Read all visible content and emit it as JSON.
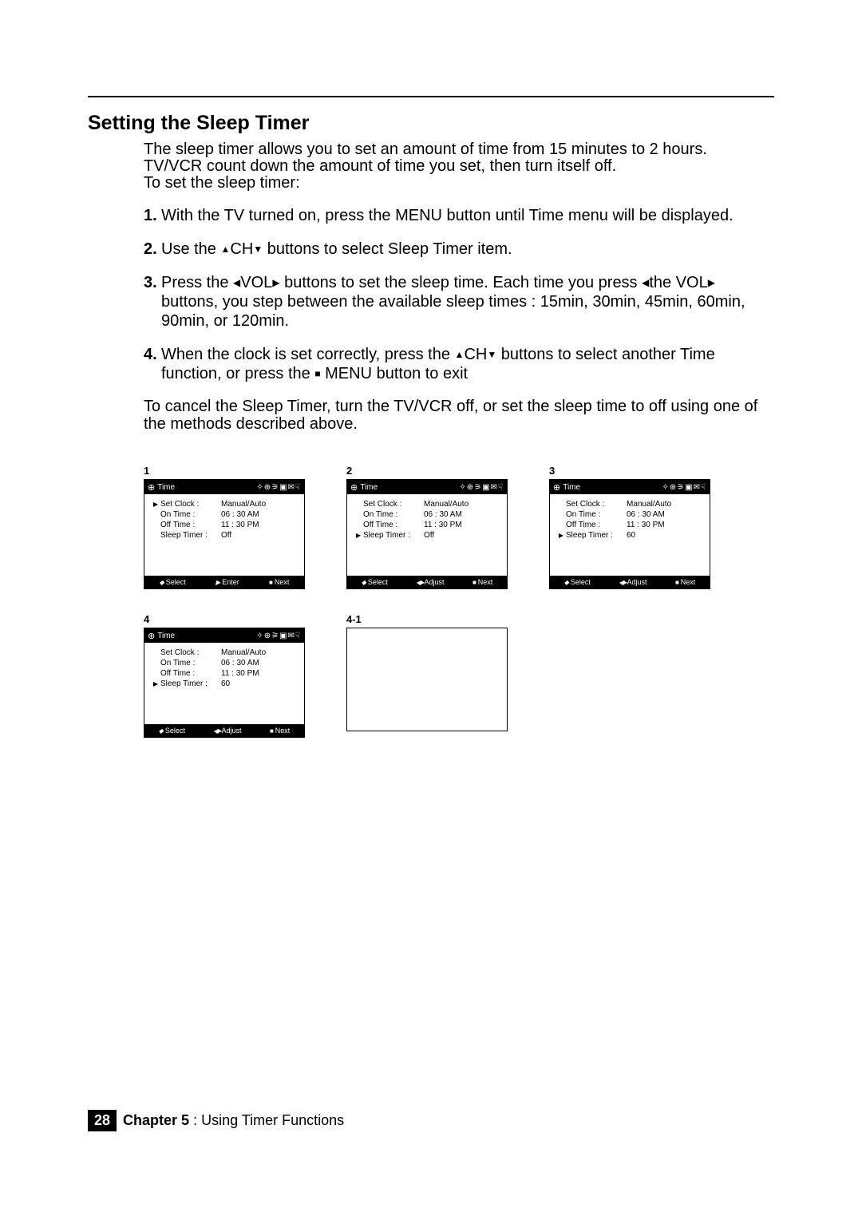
{
  "section_title": "Setting the Sleep Timer",
  "intro_lines": [
    "The sleep timer allows you to set an amount of time from 15 minutes to 2 hours.",
    "TV/VCR count down the amount of time you set, then turn itself off.",
    "To set the sleep timer:"
  ],
  "steps": {
    "s1": {
      "num": "1.",
      "text": "With the TV turned on, press the MENU button until  Time  menu will be displayed."
    },
    "s2": {
      "num": "2.",
      "pre": "Use the",
      "mid": "CH",
      "post": " buttons to select  Sleep Timer  item."
    },
    "s3": {
      "num": "3.",
      "a": "Press the",
      "b": "VOL",
      "c": " buttons to set the sleep time. Each time you press ",
      "d": "the VOL",
      "e": " buttons, you step between the available sleep times : 15min, 30min, 45min, 60min, 90min, or 120min."
    },
    "s4": {
      "num": "4.",
      "a": "When the clock is set correctly, press the ",
      "b": "CH",
      "c": " buttons to select another Time  function, or press the ",
      "d": " MENU button to exit"
    }
  },
  "postscript": "To cancel the Sleep Timer, turn the TV/VCR off, or set the sleep time to  off  using one of the methods described above.",
  "osd_header_title": "Time",
  "osd_header_icons": "✧⊕⚞▣✉☟",
  "rows": {
    "set_clock_label": "Set Clock :",
    "set_clock_val": "Manual/Auto",
    "on_time_label": "On Time :",
    "on_time_val": "06 : 30  AM",
    "off_time_label": "Off Time :",
    "off_time_val": "11 : 30  PM",
    "sleep_label": "Sleep Timer :",
    "sleep_off": "Off",
    "sleep_60": "60"
  },
  "footer_labels": {
    "select": "Select",
    "enter": "Enter",
    "adjust": "Adjust",
    "next": "Next"
  },
  "figures": {
    "f1": {
      "label": "1",
      "selected": "set_clock",
      "sleep_val": "Off",
      "mid": "enter"
    },
    "f2": {
      "label": "2",
      "selected": "sleep",
      "sleep_val": "Off",
      "mid": "adjust"
    },
    "f3": {
      "label": "3",
      "selected": "sleep",
      "sleep_val": "60",
      "mid": "adjust"
    },
    "f4": {
      "label": "4",
      "selected": "sleep",
      "sleep_val": "60",
      "mid": "adjust"
    },
    "f41": {
      "label": "4-1"
    }
  },
  "footer": {
    "page": "28",
    "chapter_bold": "Chapter 5",
    "chapter_rest": " : Using Timer Functions"
  }
}
